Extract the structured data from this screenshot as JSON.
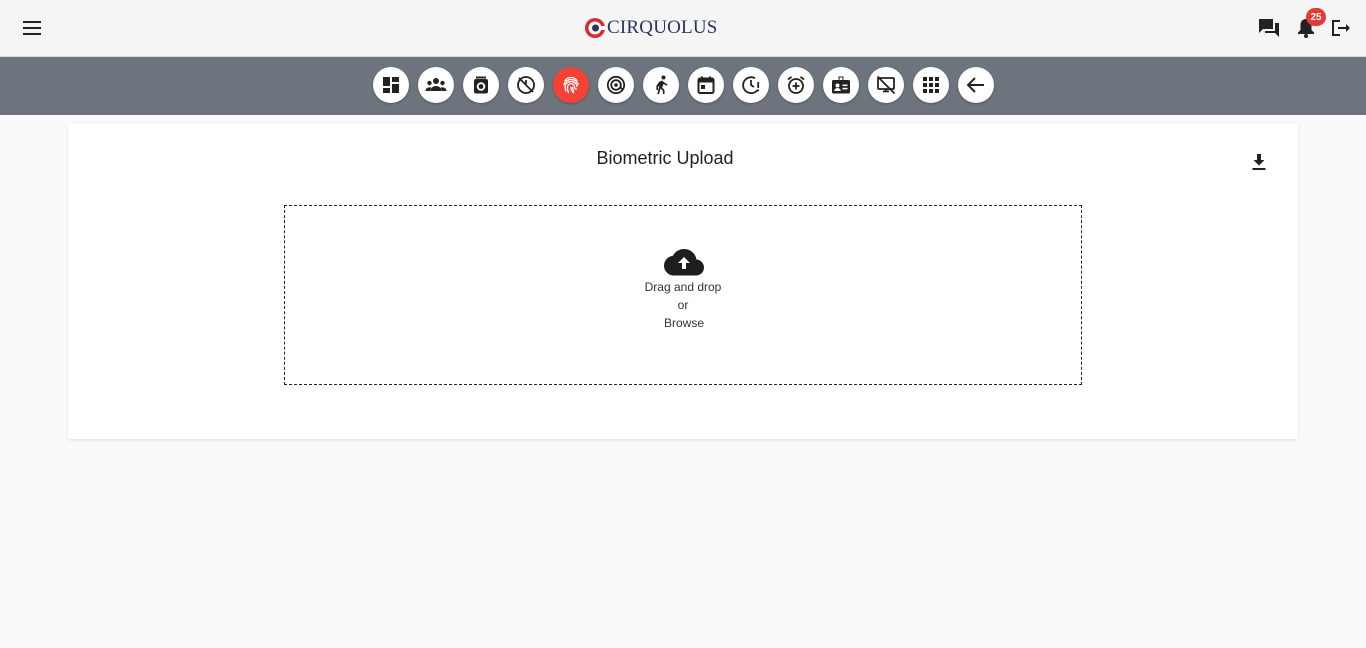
{
  "header": {
    "logo_text": "CIRQUOLUS",
    "notification_count": "25",
    "icons": [
      "menu-icon",
      "chat-icon",
      "bell-icon",
      "logout-icon"
    ]
  },
  "toolbar": {
    "items": [
      {
        "icon": "dashboard-icon"
      },
      {
        "icon": "groups-icon"
      },
      {
        "icon": "timer-icon"
      },
      {
        "icon": "timer-off-icon"
      },
      {
        "icon": "fingerprint-icon",
        "active": true
      },
      {
        "icon": "at-target-icon"
      },
      {
        "icon": "directions-run-icon"
      },
      {
        "icon": "calendar-icon"
      },
      {
        "icon": "pending-clock-icon"
      },
      {
        "icon": "alarm-add-icon"
      },
      {
        "icon": "badge-icon"
      },
      {
        "icon": "desktop-off-icon"
      },
      {
        "icon": "apps-grid-icon"
      },
      {
        "icon": "back-arrow-icon"
      }
    ],
    "active_color": "#f44336",
    "bar_color": "#6d747d"
  },
  "card": {
    "title": "Biometric Upload",
    "download_icon": "download-icon"
  },
  "dropzone": {
    "icon": "cloud-upload-icon",
    "line1": "Drag and drop",
    "line2": "or",
    "line3": "Browse"
  }
}
